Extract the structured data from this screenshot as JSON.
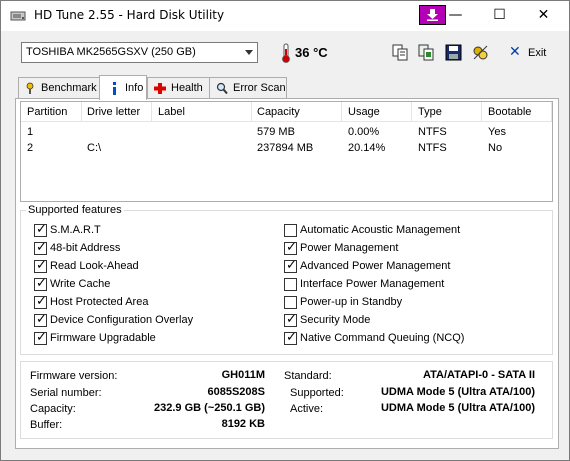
{
  "window": {
    "title": "HD Tune 2.55 - Hard Disk Utility",
    "min_glyph": "—",
    "max_glyph": "☐",
    "close_glyph": "✕"
  },
  "toolbar": {
    "drive": "TOSHIBA MK2565GSXV (250 GB)",
    "temperature": "36 °C",
    "exit_label": "Exit"
  },
  "tabs": [
    {
      "label": "Benchmark",
      "icon": "benchmark-icon"
    },
    {
      "label": "Info",
      "icon": "info-icon",
      "active": true
    },
    {
      "label": "Health",
      "icon": "health-cross-icon"
    },
    {
      "label": "Error Scan",
      "icon": "magnifier-icon"
    }
  ],
  "partitions": {
    "columns": [
      "Partition",
      "Drive letter",
      "Label",
      "Capacity",
      "Usage",
      "Type",
      "Bootable"
    ],
    "rows": [
      [
        "1",
        "",
        "",
        "579 MB",
        "0.00%",
        "NTFS",
        "Yes"
      ],
      [
        "2",
        "C:\\",
        "",
        "237894 MB",
        "20.14%",
        "NTFS",
        "No"
      ]
    ]
  },
  "features": {
    "title": "Supported features",
    "left": [
      {
        "label": "S.M.A.R.T",
        "checked": true
      },
      {
        "label": "48-bit Address",
        "checked": true
      },
      {
        "label": "Read Look-Ahead",
        "checked": true
      },
      {
        "label": "Write Cache",
        "checked": true
      },
      {
        "label": "Host Protected Area",
        "checked": true
      },
      {
        "label": "Device Configuration Overlay",
        "checked": true
      },
      {
        "label": "Firmware Upgradable",
        "checked": true
      }
    ],
    "right": [
      {
        "label": "Automatic Acoustic Management",
        "checked": false
      },
      {
        "label": "Power Management",
        "checked": true
      },
      {
        "label": "Advanced Power Management",
        "checked": true
      },
      {
        "label": "Interface Power Management",
        "checked": false
      },
      {
        "label": "Power-up in Standby",
        "checked": false
      },
      {
        "label": "Security Mode",
        "checked": true
      },
      {
        "label": "Native Command Queuing (NCQ)",
        "checked": true
      }
    ]
  },
  "info": {
    "firmware_label": "Firmware version:",
    "firmware": "GH011M",
    "serial_label": "Serial number:",
    "serial": "6085S208S",
    "capacity_label": "Capacity:",
    "capacity": "232.9 GB (~250.1 GB)",
    "buffer_label": "Buffer:",
    "buffer": "8192 KB",
    "standard_label": "Standard:",
    "standard": "ATA/ATAPI-0 - SATA II",
    "supported_label": "Supported:",
    "supported": "UDMA Mode 5 (Ultra ATA/100)",
    "active_label": "Active:",
    "active": "UDMA Mode 5 (Ultra ATA/100)"
  },
  "colors": {
    "accent_button": "#b400b4",
    "thermometer": "#d00000"
  }
}
